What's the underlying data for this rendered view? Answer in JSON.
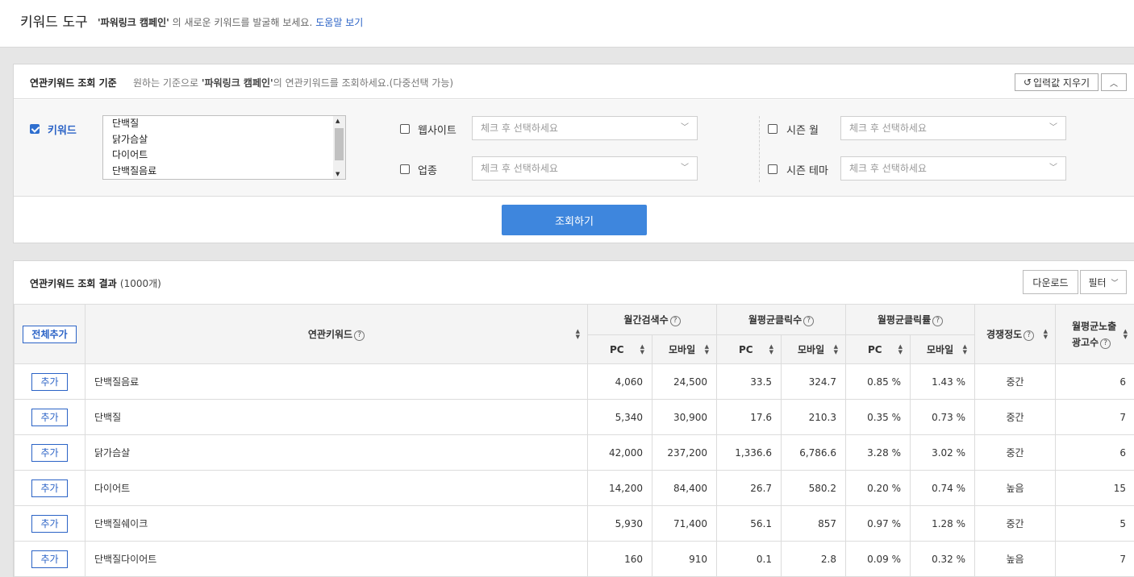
{
  "header": {
    "title": "키워드 도구",
    "campaign": "'파워링크 캠페인'",
    "desc_suffix": " 의 새로운 키워드를 발굴해 보세요.",
    "help_link": "도움말 보기"
  },
  "criteria_panel": {
    "title": "연관키워드 조회 기준",
    "sub_prefix": "원하는 기준으로 ",
    "sub_campaign": "'파워링크 캠페인'",
    "sub_suffix": "의 연관키워드를 조회하세요.(다중선택 가능)",
    "clear_label": "입력값 지우기",
    "keyword": {
      "label": "키워드",
      "checked": true,
      "items": [
        "단백질",
        "닭가슴살",
        "다이어트",
        "단백질음료"
      ]
    },
    "website": {
      "label": "웹사이트",
      "placeholder": "체크 후 선택하세요"
    },
    "industry": {
      "label": "업종",
      "placeholder": "체크 후 선택하세요"
    },
    "season_month": {
      "label": "시즌 월",
      "placeholder": "체크 후 선택하세요"
    },
    "season_theme": {
      "label": "시즌 테마",
      "placeholder": "체크 후 선택하세요"
    },
    "search_label": "조회하기"
  },
  "results_panel": {
    "title": "연관키워드 조회 결과",
    "count": "(1000개)",
    "download_label": "다운로드",
    "filter_label": "필터",
    "add_all_label": "전체추가",
    "add_label": "추가",
    "columns": {
      "keyword": "연관키워드",
      "monthly_search": "월간검색수",
      "avg_clicks": "월평균클릭수",
      "avg_ctr": "월평균클릭률",
      "competition": "경쟁정도",
      "avg_ads_line1": "월평균노출",
      "avg_ads_line2": "광고수",
      "pc": "PC",
      "mobile": "모바일"
    },
    "rows": [
      {
        "keyword": "단백질음료",
        "search_pc": "4,060",
        "search_mobile": "24,500",
        "clicks_pc": "33.5",
        "clicks_mobile": "324.7",
        "ctr_pc": "0.85 %",
        "ctr_mobile": "1.43 %",
        "competition": "중간",
        "ads": "6"
      },
      {
        "keyword": "단백질",
        "search_pc": "5,340",
        "search_mobile": "30,900",
        "clicks_pc": "17.6",
        "clicks_mobile": "210.3",
        "ctr_pc": "0.35 %",
        "ctr_mobile": "0.73 %",
        "competition": "중간",
        "ads": "7"
      },
      {
        "keyword": "닭가슴살",
        "search_pc": "42,000",
        "search_mobile": "237,200",
        "clicks_pc": "1,336.6",
        "clicks_mobile": "6,786.6",
        "ctr_pc": "3.28 %",
        "ctr_mobile": "3.02 %",
        "competition": "중간",
        "ads": "6"
      },
      {
        "keyword": "다이어트",
        "search_pc": "14,200",
        "search_mobile": "84,400",
        "clicks_pc": "26.7",
        "clicks_mobile": "580.2",
        "ctr_pc": "0.20 %",
        "ctr_mobile": "0.74 %",
        "competition": "높음",
        "ads": "15"
      },
      {
        "keyword": "단백질쉐이크",
        "search_pc": "5,930",
        "search_mobile": "71,400",
        "clicks_pc": "56.1",
        "clicks_mobile": "857",
        "ctr_pc": "0.97 %",
        "ctr_mobile": "1.28 %",
        "competition": "중간",
        "ads": "5"
      },
      {
        "keyword": "단백질다이어트",
        "search_pc": "160",
        "search_mobile": "910",
        "clicks_pc": "0.1",
        "clicks_mobile": "2.8",
        "ctr_pc": "0.09 %",
        "ctr_mobile": "0.32 %",
        "competition": "높음",
        "ads": "7"
      }
    ]
  },
  "colors": {
    "accent": "#3e86dd",
    "link": "#2b63c6"
  }
}
